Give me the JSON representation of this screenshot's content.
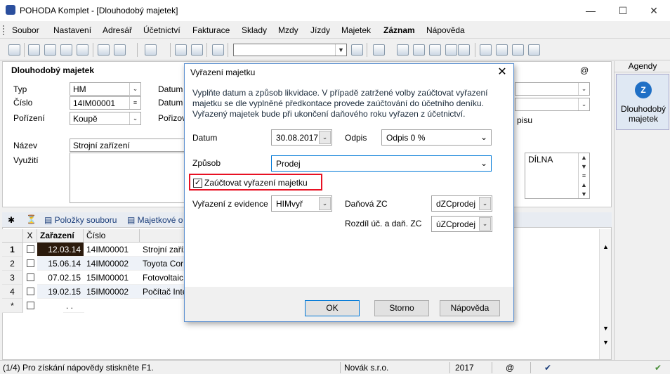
{
  "window": {
    "title": "POHODA Komplet - [Dlouhodobý majetek]"
  },
  "menu": [
    "Soubor",
    "Nastavení",
    "Adresář",
    "Účetnictví",
    "Fakturace",
    "Sklady",
    "Mzdy",
    "Jízdy",
    "Majetek",
    "Záznam",
    "Nápověda"
  ],
  "form": {
    "heading": "Dlouhodobý majetek",
    "at_label": "@",
    "typ_label": "Typ",
    "typ_value": "HM",
    "cislo_label": "Číslo",
    "cislo_value": "14IM00001",
    "porizeni_label": "Pořízení",
    "porizeni_value": "Koupě",
    "datum1_label": "Datum",
    "datum2_label": "Datum",
    "porizov_label": "Pořizov",
    "nazev_label": "Název",
    "nazev_value": "Strojní zařízení",
    "vyuziti_label": "Využití",
    "pisu_text": "pisu",
    "dilna_value": "DÍLNA"
  },
  "grid": {
    "tab1": "Položky souboru",
    "tab2": "Majetkové o",
    "col_x": "X",
    "col_zarazeni": "Zařazení",
    "col_cislo": "Číslo",
    "rows": [
      {
        "n": "1",
        "date": "12.03.14",
        "num": "14IM00001",
        "name": "Strojní zaříz"
      },
      {
        "n": "2",
        "date": "15.06.14",
        "num": "14IM00002",
        "name": "Toyota Cor"
      },
      {
        "n": "3",
        "date": "07.02.15",
        "num": "15IM00001",
        "name": "Fotovoltaic"
      },
      {
        "n": "4",
        "date": "19.02.15",
        "num": "15IM00002",
        "name": "Počítač Inte"
      }
    ],
    "new_row_marker": "*",
    "new_row_dots": ". ."
  },
  "agendy": {
    "title": "Agendy",
    "item": "Dlouhodobý majetek"
  },
  "status": {
    "help": "(1/4) Pro získání nápovědy stiskněte F1.",
    "company": "Novák s.r.o.",
    "year": "2017",
    "at": "@"
  },
  "dialog": {
    "title": "Vyřazení majetku",
    "info": "Vyplňte datum a způsob likvidace. V případě zatržené volby zaúčtovat vyřazení majetku se dle vyplněné předkontace provede zaúčtování do účetního deníku. Vyřazený majetek bude při ukončení daňového roku vyřazen z účetnictví.",
    "datum_label": "Datum",
    "datum_value": "30.08.2017",
    "odpis_label": "Odpis",
    "odpis_value": "Odpis 0 %",
    "zpusob_label": "Způsob",
    "zpusob_value": "Prodej",
    "checkbox_label": "Zaúčtovat vyřazení majetku",
    "evidence_label": "Vyřazení z evidence",
    "evidence_value": "HIMvyř",
    "danova_label": "Daňová ZC",
    "danova_value": "dZCprodej",
    "rozdil_label": "Rozdíl úč. a daň. ZC",
    "rozdil_value": "úZCprodej",
    "ok": "OK",
    "storno": "Storno",
    "napoveda": "Nápověda"
  },
  "colors": {
    "accent": "#0078d7",
    "highlight": "#e81123"
  }
}
